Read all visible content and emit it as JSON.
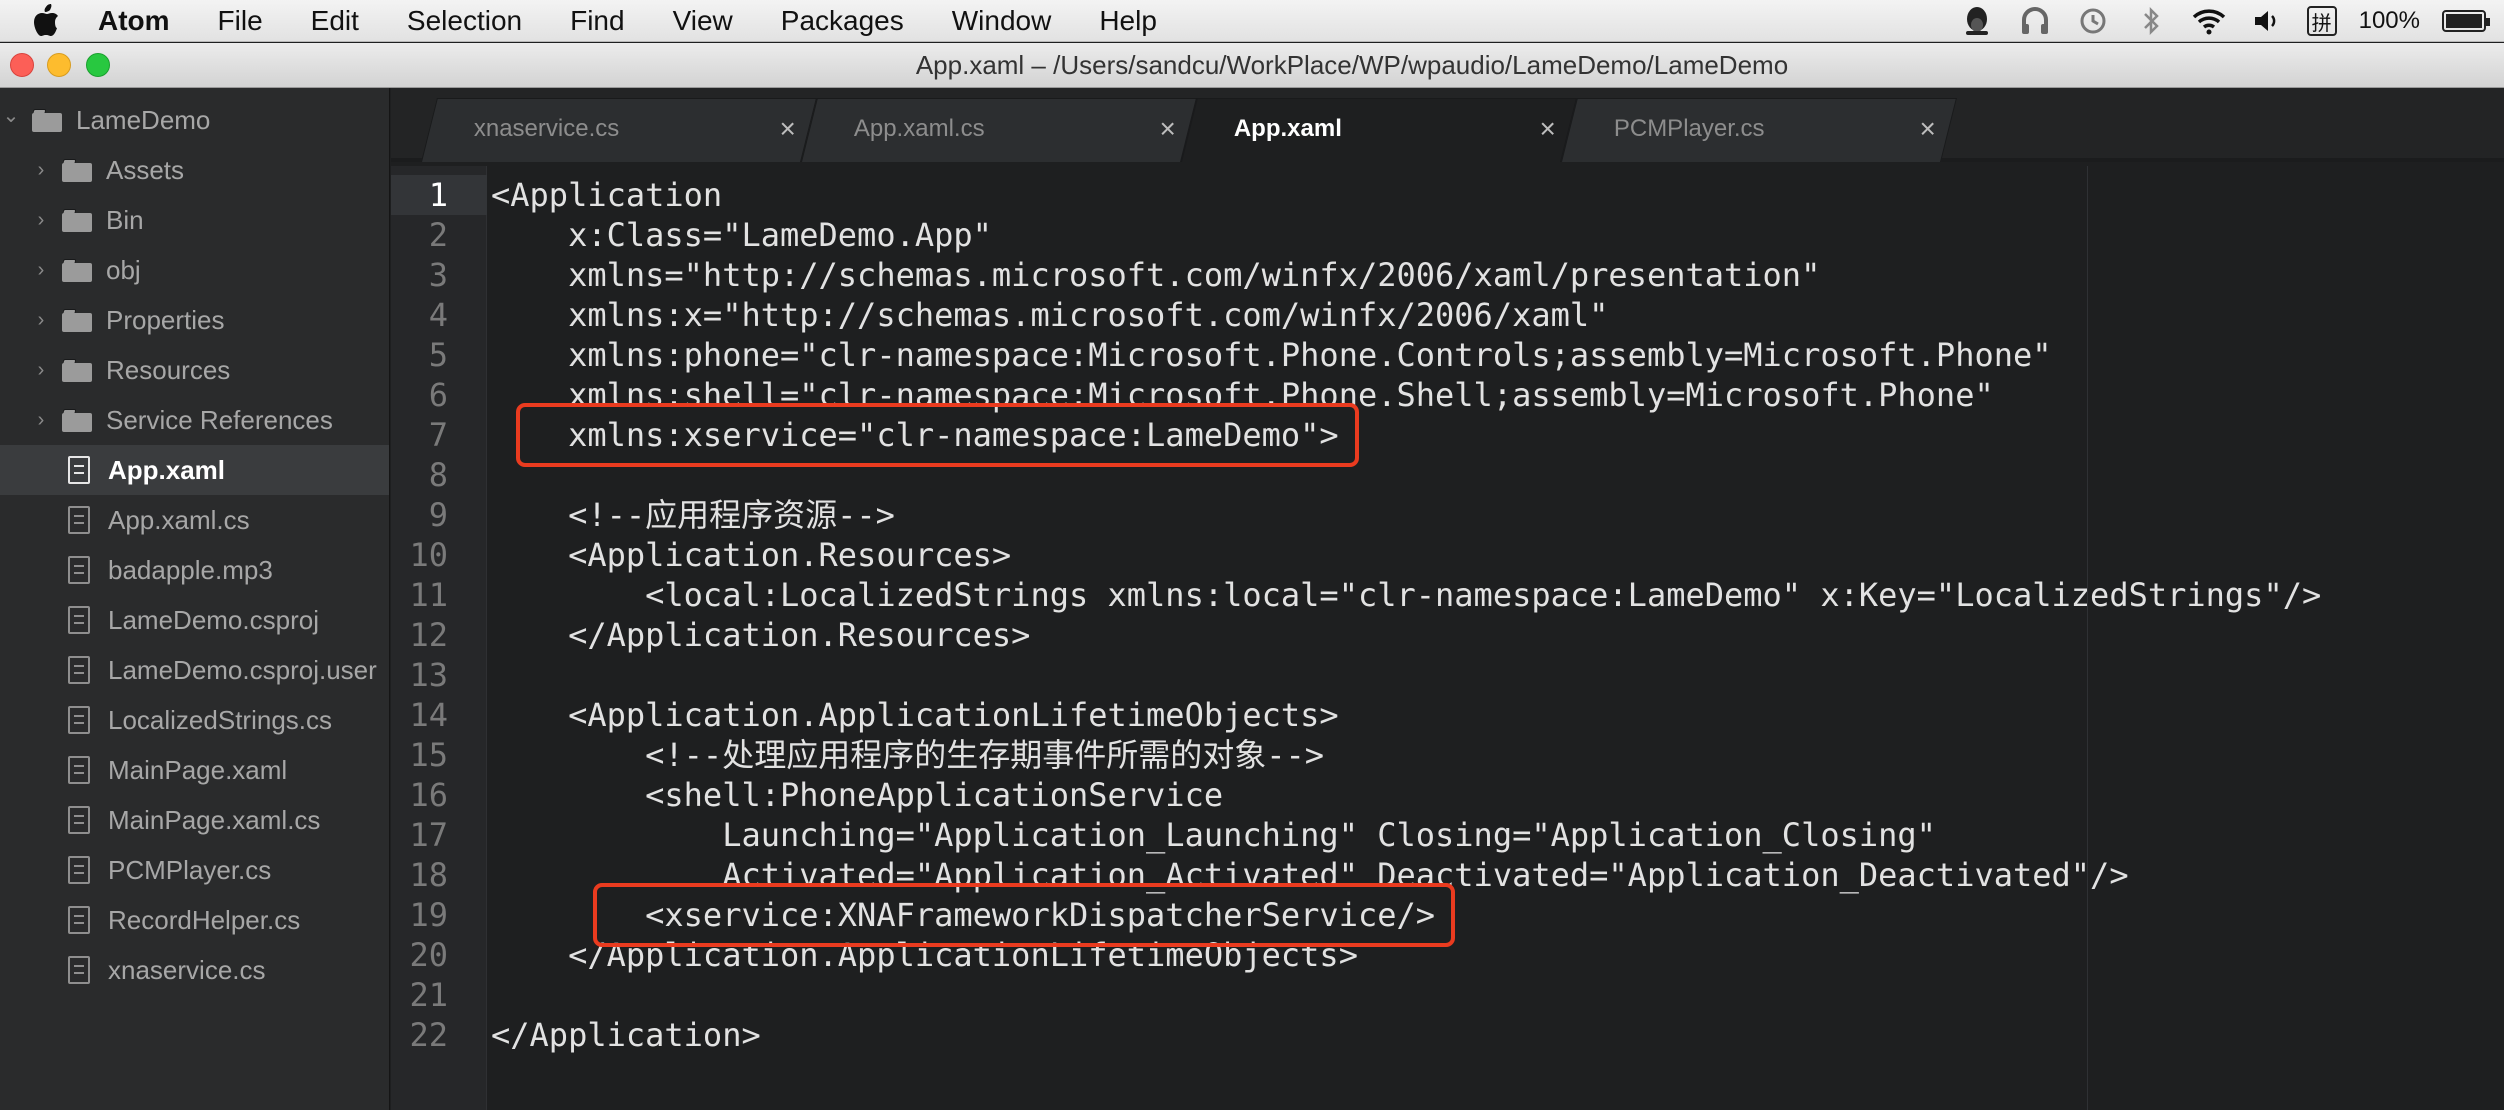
{
  "menubar": {
    "app_name": "Atom",
    "items": [
      "File",
      "Edit",
      "Selection",
      "Find",
      "View",
      "Packages",
      "Window",
      "Help"
    ],
    "status_icons": [
      "qq-penguin-icon",
      "headphones-icon",
      "time-machine-icon",
      "bluetooth-icon",
      "wifi-icon",
      "volume-icon",
      "input-method-icon"
    ],
    "input_method_glyph": "拼",
    "battery_text": "100%",
    "battery_level": 1.0
  },
  "window": {
    "title": "App.xaml – /Users/sandcu/WorkPlace/WP/wpaudio/LameDemo/LameDemo"
  },
  "sidebar": {
    "root": "LameDemo",
    "folders": [
      "Assets",
      "Bin",
      "obj",
      "Properties",
      "Resources",
      "Service References"
    ],
    "files": [
      "App.xaml",
      "App.xaml.cs",
      "badapple.mp3",
      "LameDemo.csproj",
      "LameDemo.csproj.user",
      "LocalizedStrings.cs",
      "MainPage.xaml",
      "MainPage.xaml.cs",
      "PCMPlayer.cs",
      "RecordHelper.cs",
      "xnaservice.cs"
    ],
    "selected_file": "App.xaml"
  },
  "tabs": [
    {
      "label": "xnaservice.cs",
      "active": false
    },
    {
      "label": "App.xaml.cs",
      "active": false
    },
    {
      "label": "App.xaml",
      "active": true
    },
    {
      "label": "PCMPlayer.cs",
      "active": false
    }
  ],
  "tab_close_glyph": "×",
  "editor": {
    "current_line": 1,
    "lines": [
      "<Application",
      "    x:Class=\"LameDemo.App\"",
      "    xmlns=\"http://schemas.microsoft.com/winfx/2006/xaml/presentation\"",
      "    xmlns:x=\"http://schemas.microsoft.com/winfx/2006/xaml\"",
      "    xmlns:phone=\"clr-namespace:Microsoft.Phone.Controls;assembly=Microsoft.Phone\"",
      "    xmlns:shell=\"clr-namespace:Microsoft.Phone.Shell;assembly=Microsoft.Phone\"",
      "    xmlns:xservice=\"clr-namespace:LameDemo\">",
      "",
      "    <!--应用程序资源-->",
      "    <Application.Resources>",
      "        <local:LocalizedStrings xmlns:local=\"clr-namespace:LameDemo\" x:Key=\"LocalizedStrings\"/>",
      "    </Application.Resources>",
      "",
      "    <Application.ApplicationLifetimeObjects>",
      "        <!--处理应用程序的生存期事件所需的对象-->",
      "        <shell:PhoneApplicationService",
      "            Launching=\"Application_Launching\" Closing=\"Application_Closing\"",
      "            Activated=\"Application_Activated\" Deactivated=\"Application_Deactivated\"/>",
      "        <xservice:XNAFrameworkDispatcherService/>",
      "    </Application.ApplicationLifetimeObjects>",
      "",
      "</Application>"
    ],
    "highlighted_lines": [
      7,
      19
    ],
    "annotation_color": "#ea3b1f"
  }
}
